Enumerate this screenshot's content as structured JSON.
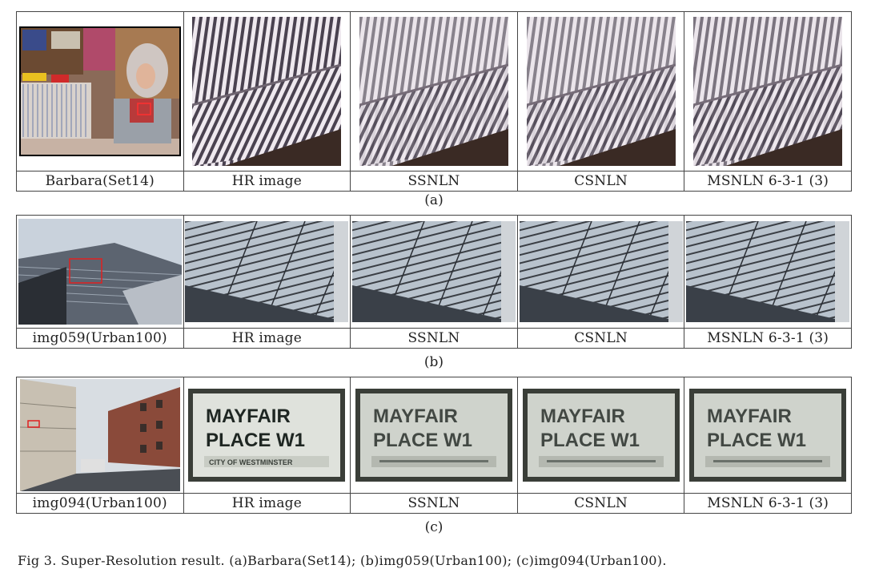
{
  "rows": [
    {
      "id": "a",
      "source": "Barbara(Set14)",
      "columns": [
        "HR image",
        "SSNLN",
        "CSNLN",
        "MSNLN 6-3-1 (3)"
      ],
      "label": "(a)"
    },
    {
      "id": "b",
      "source": "img059(Urban100)",
      "columns": [
        "HR image",
        "SSNLN",
        "CSNLN",
        "MSNLN 6-3-1 (3)"
      ],
      "label": "(b)"
    },
    {
      "id": "c",
      "source": "img094(Urban100)",
      "columns": [
        "HR image",
        "SSNLN",
        "CSNLN",
        "MSNLN 6-3-1 (3)"
      ],
      "label": "(c)"
    }
  ],
  "sign": {
    "line1": "MAYFAIR",
    "line2": "PLACE W1",
    "line3": "CITY OF WESTMINSTER"
  },
  "caption": "Fig 3. Super-Resolution result. (a)Barbara(Set14); (b)img059(Urban100); (c)img094(Urban100)."
}
